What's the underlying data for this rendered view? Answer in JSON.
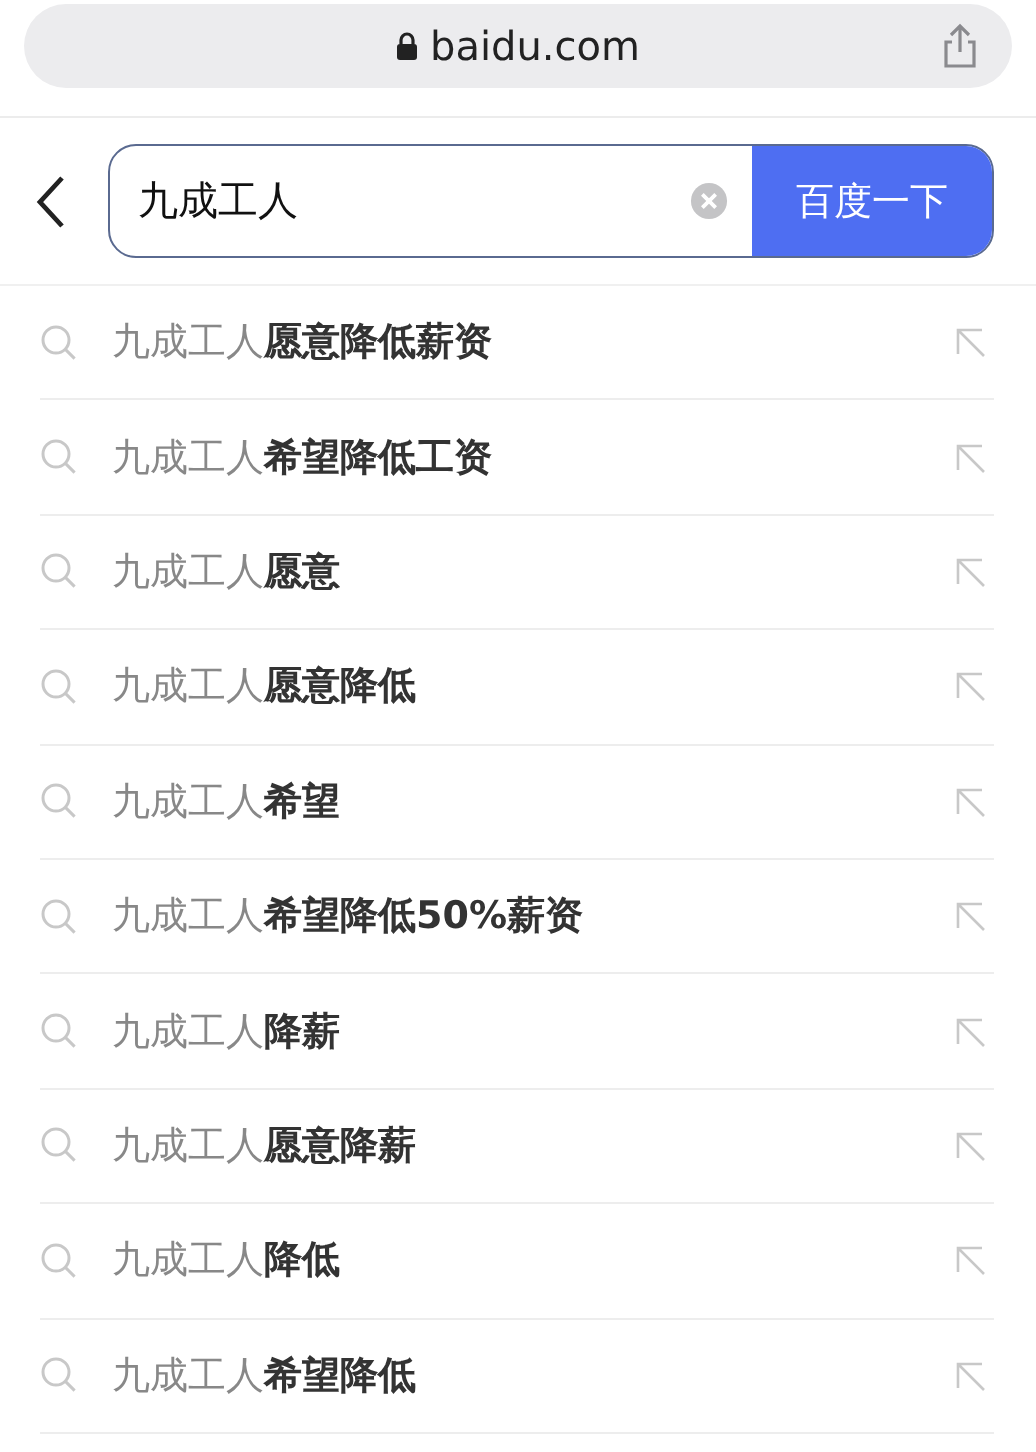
{
  "address_bar": {
    "url": "baidu.com"
  },
  "search": {
    "value": "九成工人",
    "button": "百度一下"
  },
  "suggestions": [
    {
      "text": "九成工人**愿意降低薪资**"
    },
    {
      "text": "九成工人**希望降低工资**"
    },
    {
      "text": "九成工人**愿意**"
    },
    {
      "text": "九成工人**愿意降低**"
    },
    {
      "text": "九成工人**希望**"
    },
    {
      "text": "九成工人**希望降低50%薪资**"
    },
    {
      "text": "九成工人**降薪**"
    },
    {
      "text": "九成工人**愿意降薪**"
    },
    {
      "text": "九成工人**降低**"
    },
    {
      "text": "九成工人**希望降低**"
    }
  ]
}
